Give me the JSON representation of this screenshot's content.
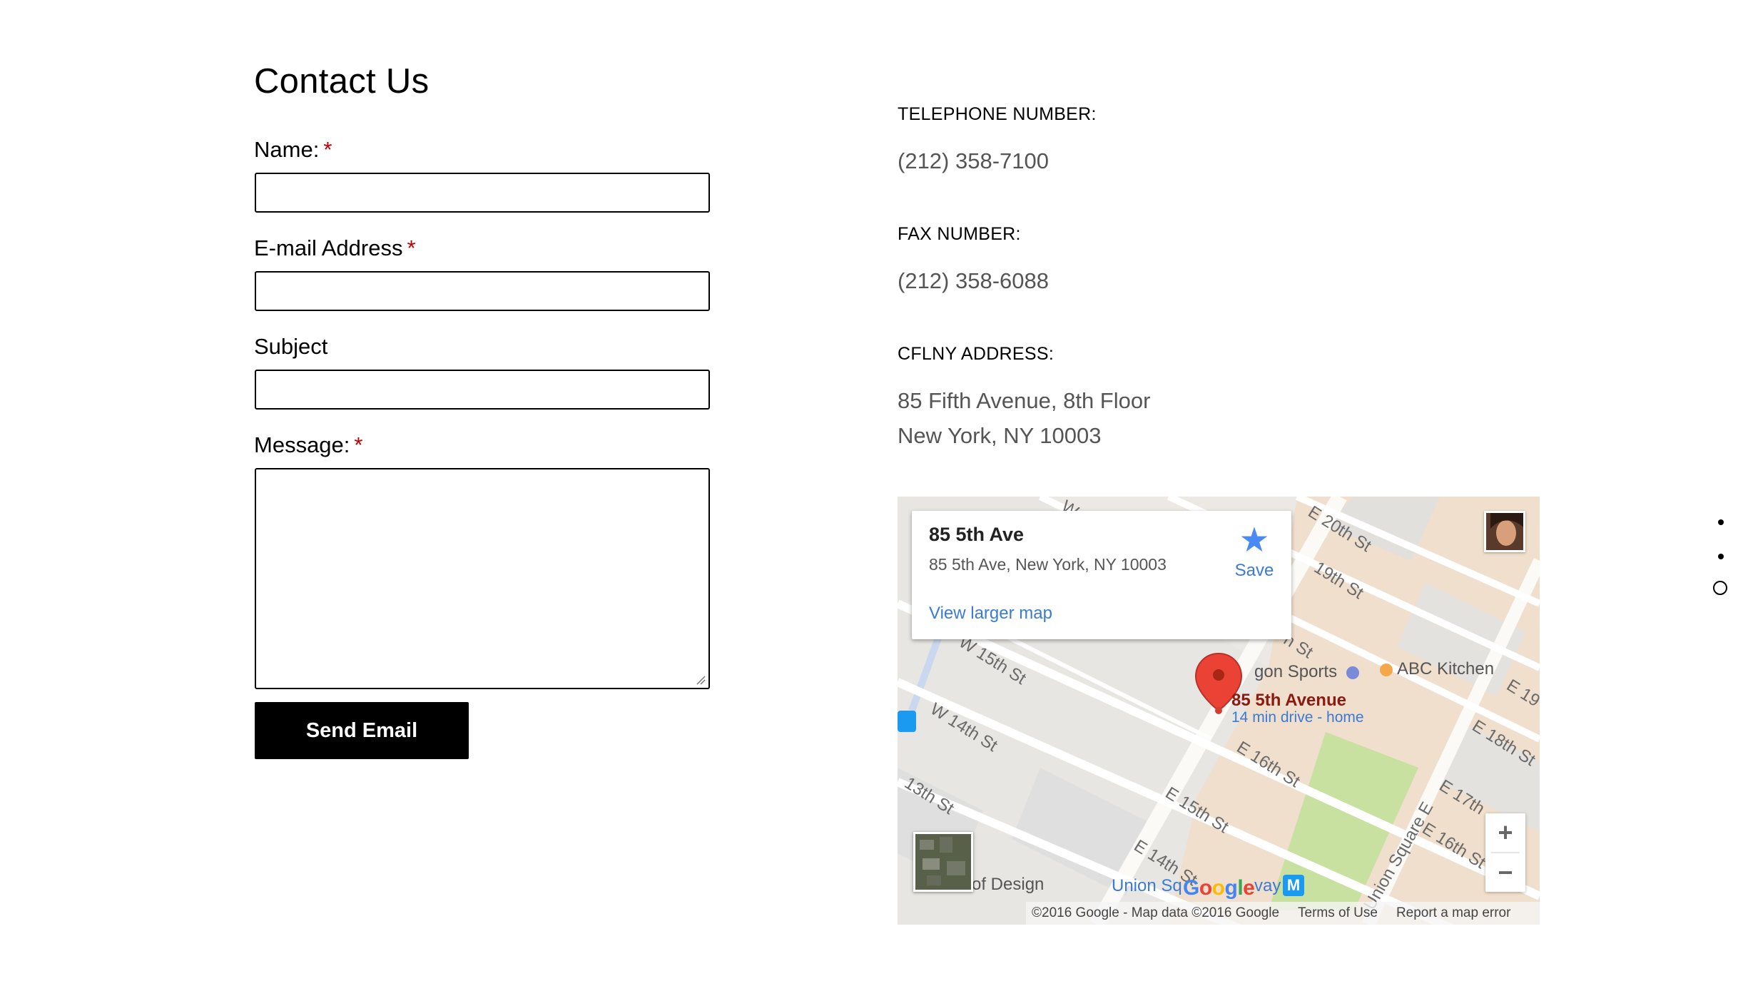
{
  "form": {
    "title": "Contact Us",
    "name_label": "Name:",
    "email_label": "E-mail Address",
    "subject_label": "Subject",
    "message_label": "Message:",
    "required_mark": "*",
    "send_button": "Send Email"
  },
  "contact": {
    "phone_label": "TELEPHONE NUMBER:",
    "phone_value": "(212) 358-7100",
    "fax_label": "FAX NUMBER:",
    "fax_value": "(212) 358-6088",
    "address_label": "CFLNY ADDRESS:",
    "address_line1": "85 Fifth Avenue, 8th Floor",
    "address_line2": "New York, NY 10003"
  },
  "map": {
    "card_title": "85 5th Ave",
    "card_address": "85 5th Ave, New York, NY 10003",
    "save_label": "Save",
    "view_larger": "View larger map",
    "pin_title": "85 5th Avenue",
    "pin_subtitle": "14 min drive - home",
    "poi_sports": "gon Sports",
    "poi_abc": "ABC Kitchen",
    "poi_design": "of Design",
    "poi_union": "Union Sq",
    "poi_way": "vay",
    "streets": {
      "w15": "W 15th St",
      "w14": "W 14th St",
      "w13": "13th St",
      "e20": "E 20th St",
      "e19": "19th St",
      "e17": "E 17th St",
      "e16": "E 16th St",
      "e15": "E 15th St",
      "e14": "E 14th St",
      "e18": "E 18th St",
      "e19b": "E 19",
      "union_sq_e": "Union Square E",
      "e16b": "E 16th St",
      "e17b": "E 17th",
      "thst": "h St",
      "w_top": "W"
    },
    "google_logo": "Google",
    "footer_copyright": "©2016 Google - Map data ©2016 Google",
    "footer_terms": "Terms of Use",
    "footer_report": "Report a map error",
    "zoom_in": "+",
    "zoom_out": "−"
  },
  "colors": {
    "required": "#c00000",
    "link_blue": "#3a7bd5",
    "pin_red": "#ea4335",
    "park_green": "#c8e0a0",
    "block_tan": "#efdfcc"
  },
  "icons": [
    "star-icon",
    "map-pin-icon",
    "subway-icon",
    "restaurant-icon",
    "shopping-icon",
    "resize-grip-icon"
  ]
}
